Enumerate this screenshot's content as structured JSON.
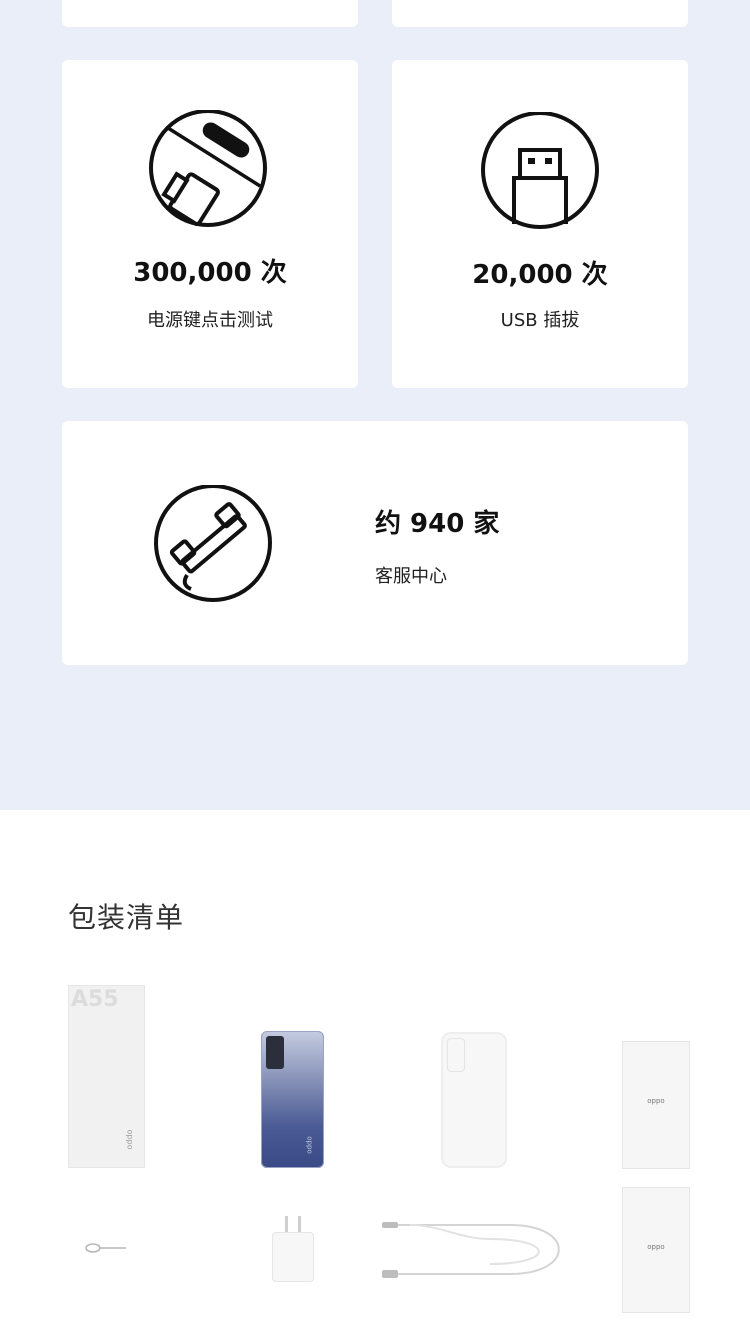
{
  "stats": [
    {
      "value": "300,000 次",
      "label": "电源键点击测试",
      "icon": "power-button-icon"
    },
    {
      "value": "20,000 次",
      "label": "USB 插拔",
      "icon": "usb-plug-icon"
    },
    {
      "value": "约 940 家",
      "label": "客服中心",
      "icon": "phone-handset-icon"
    }
  ],
  "package": {
    "title": "包装清单",
    "box_label": "A55",
    "brand_mark": "oppo",
    "items": [
      "box",
      "phone",
      "case",
      "manual",
      "sim-ejector",
      "charger",
      "usb-cable",
      "warranty-card"
    ]
  },
  "colors": {
    "section_bg": "#e9eef9",
    "card_bg": "#ffffff"
  }
}
